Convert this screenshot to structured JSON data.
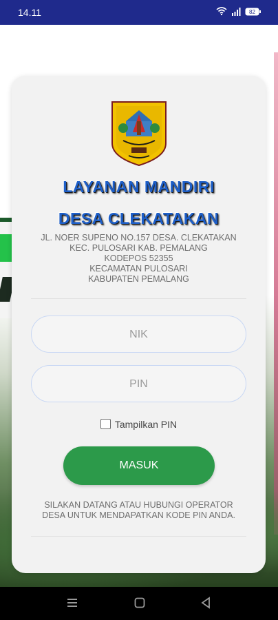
{
  "status_bar": {
    "time": "14.11",
    "battery": "82"
  },
  "header": {
    "title_line1": "LAYANAN MANDIRI",
    "title_line2": "DESA CLEKATAKAN"
  },
  "address": {
    "line1": "JL. NOER SUPENO NO.157 DESA. CLEKATAKAN",
    "line2": "KEC. PULOSARI KAB. PEMALANG",
    "line3": "KODEPOS 52355",
    "line4": "KECAMATAN PULOSARI",
    "line5": "KABUPATEN PEMALANG"
  },
  "form": {
    "nik_placeholder": "NIK",
    "pin_placeholder": "PIN",
    "show_pin_label": "Tampilkan PIN",
    "show_pin_checked": false,
    "submit_label": "MASUK"
  },
  "footer_note": {
    "line1": "SILAKAN DATANG ATAU HUBUNGI OPERATOR",
    "line2": "DESA UNTUK MENDAPATKAN KODE PIN ANDA."
  },
  "colors": {
    "status_bar": "#1f2a8c",
    "title": "#1e5fc8",
    "button": "#2c9a4a",
    "field_border": "#c8d7f4"
  },
  "icons": [
    "wifi-icon",
    "signal-icon",
    "battery-icon",
    "logo-emblem",
    "menu-nav-icon",
    "home-nav-icon",
    "back-nav-icon"
  ]
}
